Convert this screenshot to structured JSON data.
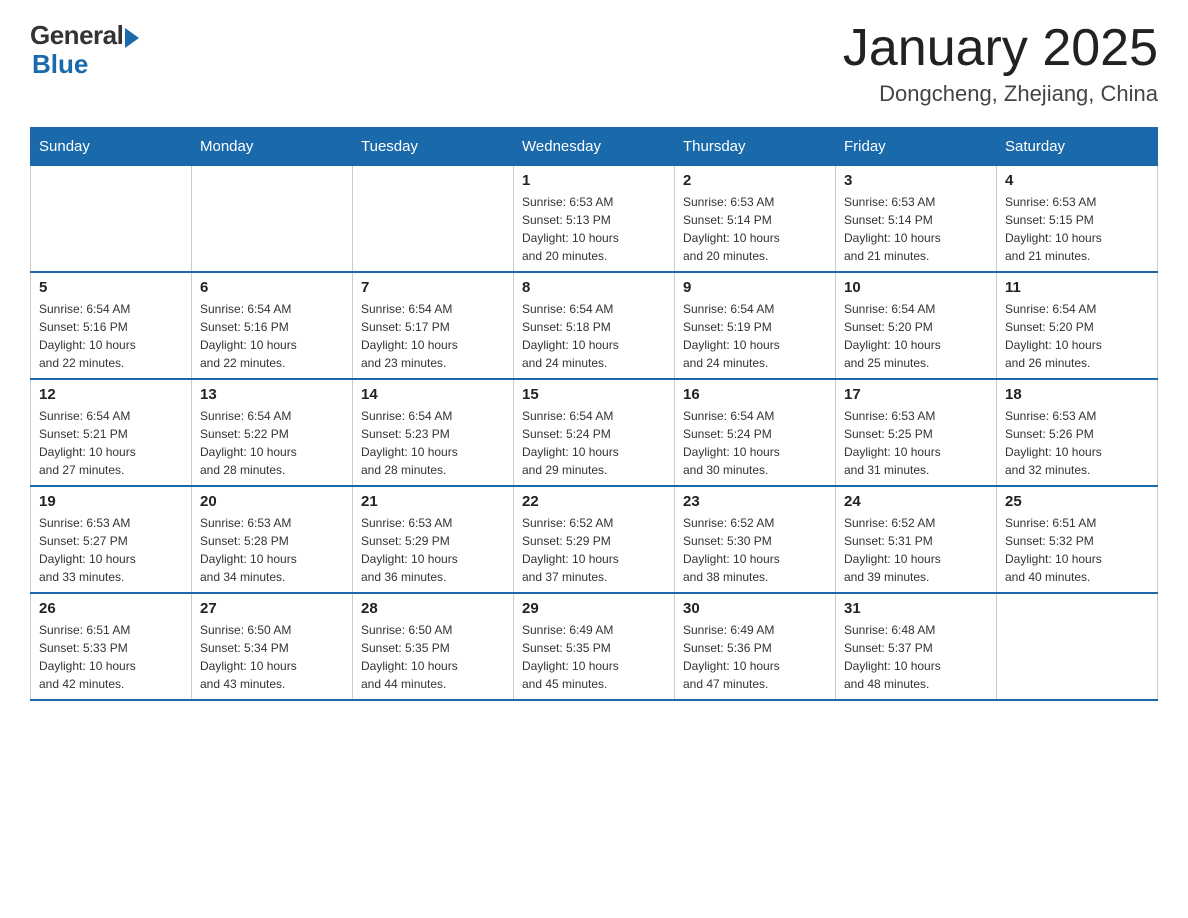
{
  "logo": {
    "general": "General",
    "blue": "Blue"
  },
  "title": "January 2025",
  "location": "Dongcheng, Zhejiang, China",
  "days_of_week": [
    "Sunday",
    "Monday",
    "Tuesday",
    "Wednesday",
    "Thursday",
    "Friday",
    "Saturday"
  ],
  "weeks": [
    [
      {
        "day": "",
        "info": ""
      },
      {
        "day": "",
        "info": ""
      },
      {
        "day": "",
        "info": ""
      },
      {
        "day": "1",
        "info": "Sunrise: 6:53 AM\nSunset: 5:13 PM\nDaylight: 10 hours\nand 20 minutes."
      },
      {
        "day": "2",
        "info": "Sunrise: 6:53 AM\nSunset: 5:14 PM\nDaylight: 10 hours\nand 20 minutes."
      },
      {
        "day": "3",
        "info": "Sunrise: 6:53 AM\nSunset: 5:14 PM\nDaylight: 10 hours\nand 21 minutes."
      },
      {
        "day": "4",
        "info": "Sunrise: 6:53 AM\nSunset: 5:15 PM\nDaylight: 10 hours\nand 21 minutes."
      }
    ],
    [
      {
        "day": "5",
        "info": "Sunrise: 6:54 AM\nSunset: 5:16 PM\nDaylight: 10 hours\nand 22 minutes."
      },
      {
        "day": "6",
        "info": "Sunrise: 6:54 AM\nSunset: 5:16 PM\nDaylight: 10 hours\nand 22 minutes."
      },
      {
        "day": "7",
        "info": "Sunrise: 6:54 AM\nSunset: 5:17 PM\nDaylight: 10 hours\nand 23 minutes."
      },
      {
        "day": "8",
        "info": "Sunrise: 6:54 AM\nSunset: 5:18 PM\nDaylight: 10 hours\nand 24 minutes."
      },
      {
        "day": "9",
        "info": "Sunrise: 6:54 AM\nSunset: 5:19 PM\nDaylight: 10 hours\nand 24 minutes."
      },
      {
        "day": "10",
        "info": "Sunrise: 6:54 AM\nSunset: 5:20 PM\nDaylight: 10 hours\nand 25 minutes."
      },
      {
        "day": "11",
        "info": "Sunrise: 6:54 AM\nSunset: 5:20 PM\nDaylight: 10 hours\nand 26 minutes."
      }
    ],
    [
      {
        "day": "12",
        "info": "Sunrise: 6:54 AM\nSunset: 5:21 PM\nDaylight: 10 hours\nand 27 minutes."
      },
      {
        "day": "13",
        "info": "Sunrise: 6:54 AM\nSunset: 5:22 PM\nDaylight: 10 hours\nand 28 minutes."
      },
      {
        "day": "14",
        "info": "Sunrise: 6:54 AM\nSunset: 5:23 PM\nDaylight: 10 hours\nand 28 minutes."
      },
      {
        "day": "15",
        "info": "Sunrise: 6:54 AM\nSunset: 5:24 PM\nDaylight: 10 hours\nand 29 minutes."
      },
      {
        "day": "16",
        "info": "Sunrise: 6:54 AM\nSunset: 5:24 PM\nDaylight: 10 hours\nand 30 minutes."
      },
      {
        "day": "17",
        "info": "Sunrise: 6:53 AM\nSunset: 5:25 PM\nDaylight: 10 hours\nand 31 minutes."
      },
      {
        "day": "18",
        "info": "Sunrise: 6:53 AM\nSunset: 5:26 PM\nDaylight: 10 hours\nand 32 minutes."
      }
    ],
    [
      {
        "day": "19",
        "info": "Sunrise: 6:53 AM\nSunset: 5:27 PM\nDaylight: 10 hours\nand 33 minutes."
      },
      {
        "day": "20",
        "info": "Sunrise: 6:53 AM\nSunset: 5:28 PM\nDaylight: 10 hours\nand 34 minutes."
      },
      {
        "day": "21",
        "info": "Sunrise: 6:53 AM\nSunset: 5:29 PM\nDaylight: 10 hours\nand 36 minutes."
      },
      {
        "day": "22",
        "info": "Sunrise: 6:52 AM\nSunset: 5:29 PM\nDaylight: 10 hours\nand 37 minutes."
      },
      {
        "day": "23",
        "info": "Sunrise: 6:52 AM\nSunset: 5:30 PM\nDaylight: 10 hours\nand 38 minutes."
      },
      {
        "day": "24",
        "info": "Sunrise: 6:52 AM\nSunset: 5:31 PM\nDaylight: 10 hours\nand 39 minutes."
      },
      {
        "day": "25",
        "info": "Sunrise: 6:51 AM\nSunset: 5:32 PM\nDaylight: 10 hours\nand 40 minutes."
      }
    ],
    [
      {
        "day": "26",
        "info": "Sunrise: 6:51 AM\nSunset: 5:33 PM\nDaylight: 10 hours\nand 42 minutes."
      },
      {
        "day": "27",
        "info": "Sunrise: 6:50 AM\nSunset: 5:34 PM\nDaylight: 10 hours\nand 43 minutes."
      },
      {
        "day": "28",
        "info": "Sunrise: 6:50 AM\nSunset: 5:35 PM\nDaylight: 10 hours\nand 44 minutes."
      },
      {
        "day": "29",
        "info": "Sunrise: 6:49 AM\nSunset: 5:35 PM\nDaylight: 10 hours\nand 45 minutes."
      },
      {
        "day": "30",
        "info": "Sunrise: 6:49 AM\nSunset: 5:36 PM\nDaylight: 10 hours\nand 47 minutes."
      },
      {
        "day": "31",
        "info": "Sunrise: 6:48 AM\nSunset: 5:37 PM\nDaylight: 10 hours\nand 48 minutes."
      },
      {
        "day": "",
        "info": ""
      }
    ]
  ]
}
